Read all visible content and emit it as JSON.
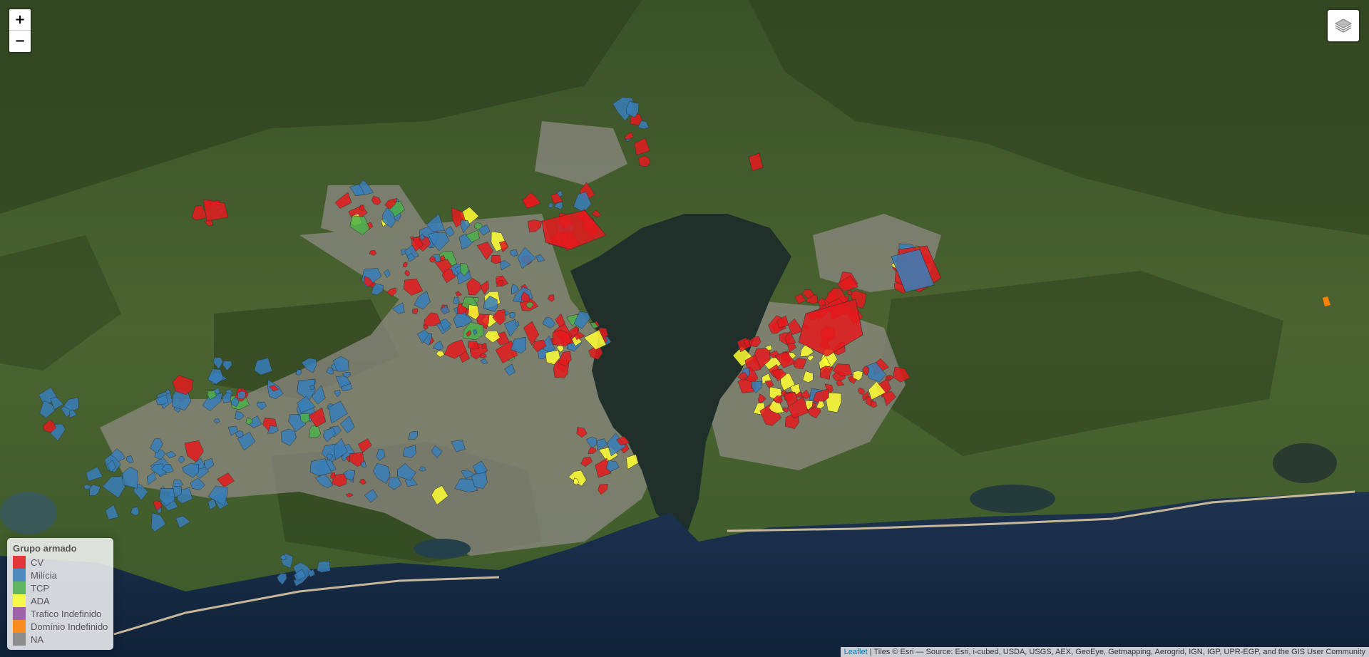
{
  "zoom": {
    "in_label": "+",
    "out_label": "−"
  },
  "layers_control": {
    "icon": "layers-icon"
  },
  "legend": {
    "title": "Grupo armado",
    "items": [
      {
        "label": "CV",
        "color": "#e41a1c"
      },
      {
        "label": "Milícia",
        "color": "#377eb8"
      },
      {
        "label": "TCP",
        "color": "#4daf4a"
      },
      {
        "label": "ADA",
        "color": "#ffff33"
      },
      {
        "label": "Trafico Indefinido",
        "color": "#984ea3"
      },
      {
        "label": "Domínio Indefinido",
        "color": "#ff7f00"
      },
      {
        "label": "NA",
        "color": "#808080"
      }
    ]
  },
  "attribution": {
    "leaflet": "Leaflet",
    "text": " | Tiles © Esri — Source: Esri, i-cubed, USDA, USGS, AEX, GeoEye, Getmapping, Aerogrid, IGN, IGP, UPR-EGP, and the GIS User Community"
  }
}
